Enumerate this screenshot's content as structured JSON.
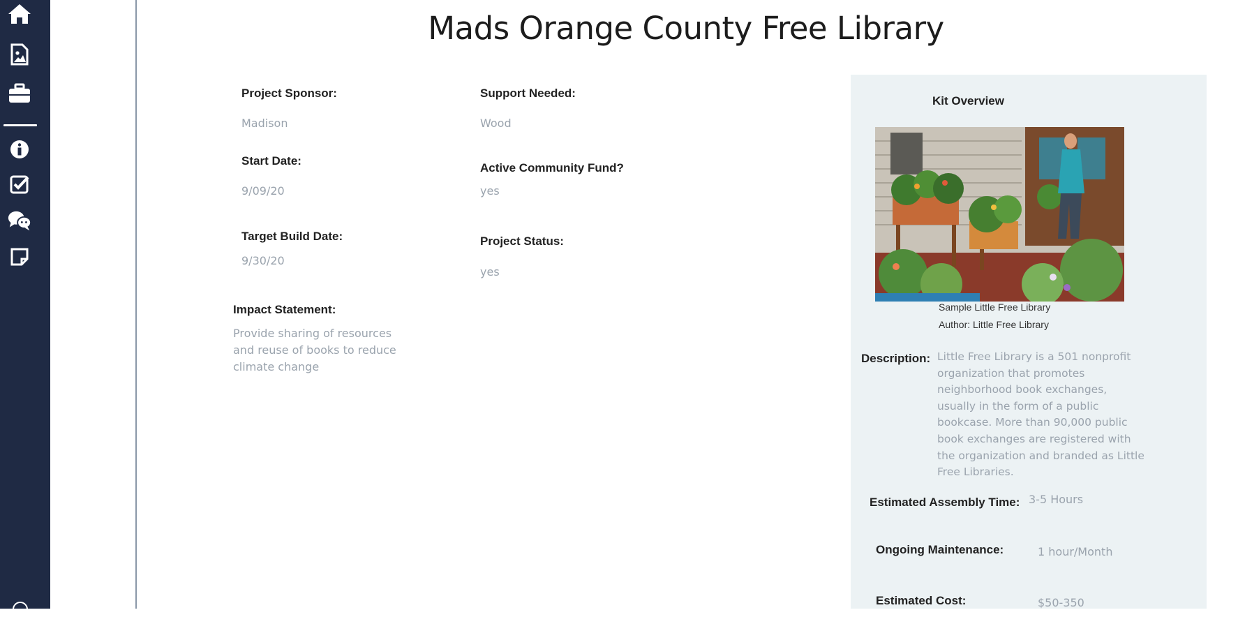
{
  "sidebar": {
    "icons": [
      "home-icon",
      "image-file-icon",
      "briefcase-icon",
      "info-icon",
      "checkbox-icon",
      "chat-icon",
      "note-icon"
    ]
  },
  "page": {
    "title": "Mads Orange County Free Library"
  },
  "details": {
    "project_sponsor_label": "Project Sponsor:",
    "project_sponsor_value": "Madison",
    "start_date_label": "Start Date:",
    "start_date_value": "9/09/20",
    "target_build_date_label": "Target Build Date:",
    "target_build_date_value": "9/30/20",
    "impact_statement_label": "Impact Statement:",
    "impact_statement_value": "Provide sharing of resources and reuse of books to reduce climate change",
    "support_needed_label": "Support Needed:",
    "support_needed_value": "Wood",
    "community_fund_label": "Active Community Fund?",
    "community_fund_value": "yes",
    "project_status_label": "Project Status:",
    "project_status_value": "yes"
  },
  "kit": {
    "title": "Kit Overview",
    "caption_title": "Sample Little Free Library",
    "caption_author": "Author: Little Free Library",
    "description_label": "Description:",
    "description_value": "Little Free Library is a 501 nonprofit organization that promotes neighborhood book exchanges, usually in the form of a public bookcase. More than 90,000 public book exchanges are registered with the organization and branded as Little Free Libraries.",
    "assembly_label": "Estimated Assembly Time:",
    "assembly_value": "3-5 Hours",
    "maintenance_label": "Ongoing Maintenance:",
    "maintenance_value": "1 hour/Month",
    "cost_label": "Estimated Cost:",
    "cost_value": "$50-350"
  },
  "colors": {
    "sidebar_bg": "#1f2a44",
    "panel_bg": "#ecf2f4",
    "value_text": "#9aa3ad",
    "label_text": "#222222"
  }
}
